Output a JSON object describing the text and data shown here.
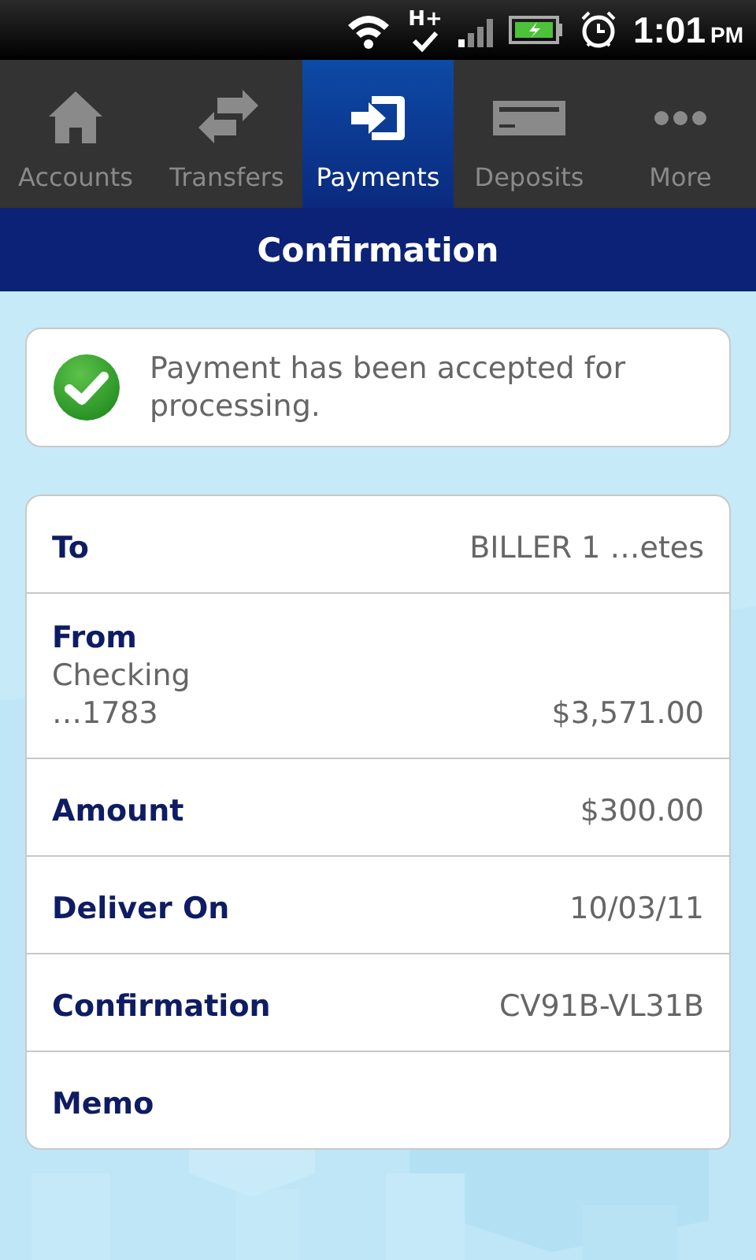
{
  "status_bar": {
    "network": "H+",
    "time": "1:01",
    "period": "PM"
  },
  "tabs": [
    {
      "label": "Accounts",
      "kind": "home",
      "selected": false
    },
    {
      "label": "Transfers",
      "kind": "transfer",
      "selected": false
    },
    {
      "label": "Payments",
      "kind": "payment",
      "selected": true
    },
    {
      "label": "Deposits",
      "kind": "deposit",
      "selected": false
    },
    {
      "label": "More",
      "kind": "more",
      "selected": false
    }
  ],
  "header": {
    "title": "Confirmation"
  },
  "message": {
    "text": "Payment has been accepted for processing."
  },
  "details": [
    {
      "label": "To",
      "value": "BILLER 1 …etes"
    },
    {
      "label": "From",
      "lines": [
        "Checking",
        "…1783"
      ],
      "value": "$3,571.00"
    },
    {
      "label": "Amount",
      "value": "$300.00"
    },
    {
      "label": "Deliver On",
      "value": "10/03/11"
    },
    {
      "label": "Confirmation",
      "value": "CV91B-VL31B"
    },
    {
      "label": "Memo"
    }
  ]
}
